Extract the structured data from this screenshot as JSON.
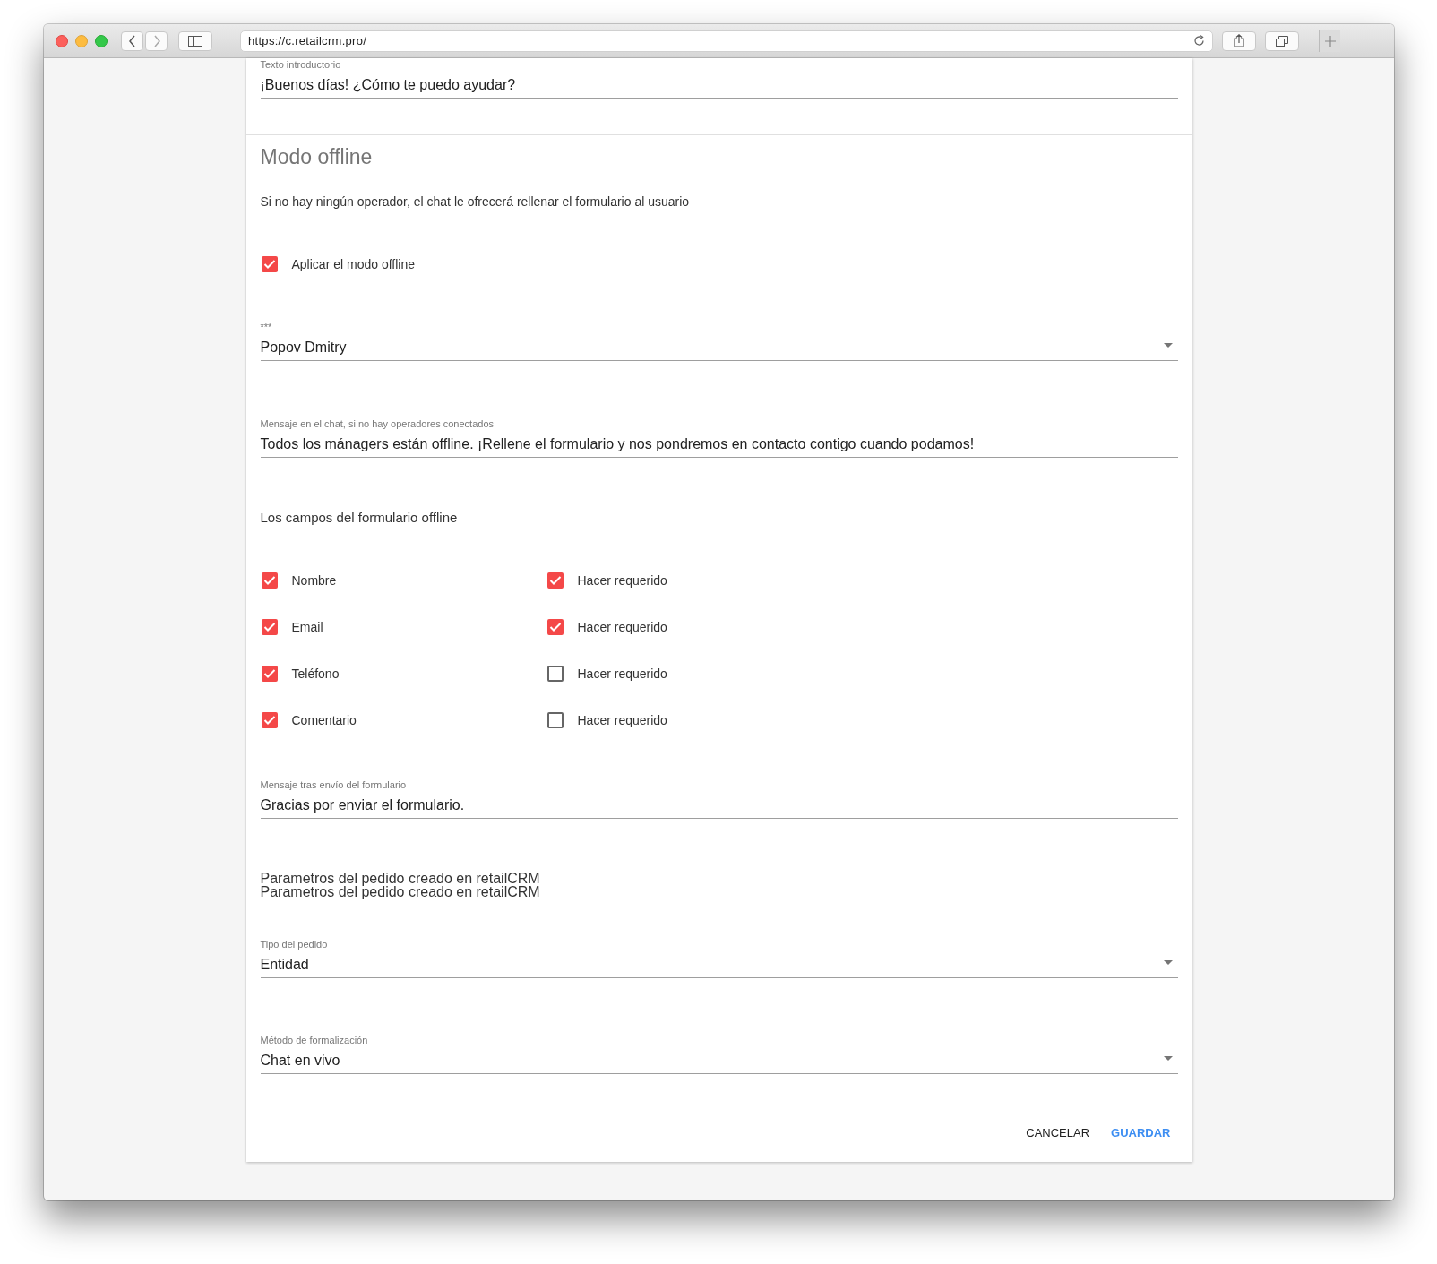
{
  "browser": {
    "url": "https://c.retailcrm.pro/"
  },
  "intro_field": {
    "label": "Texto introductorio",
    "value": "¡Buenos días! ¿Cómo te puedo ayudar?"
  },
  "offline_section": {
    "title": "Modo offline",
    "description": "Si no hay ningún operador, el chat le ofrecerá rellenar el formulario al usuario",
    "apply_checkbox": {
      "label": "Aplicar el modo offline",
      "checked": true
    },
    "operator_select": {
      "label": "***",
      "value": "Popov Dmitry"
    },
    "message_field": {
      "label": "Mensaje en el chat, si no hay operadores conectados",
      "value": "Todos los mánagers están offline. ¡Rellene el formulario y nos pondremos en contacto contigo cuando podamos!"
    },
    "form_fields_heading": "Los campos del formulario offline",
    "form_fields": [
      {
        "label": "Nombre",
        "checked": true,
        "required_label": "Hacer requerido",
        "required": true
      },
      {
        "label": "Email",
        "checked": true,
        "required_label": "Hacer requerido",
        "required": true
      },
      {
        "label": "Teléfono",
        "checked": true,
        "required_label": "Hacer requerido",
        "required": false
      },
      {
        "label": "Comentario",
        "checked": true,
        "required_label": "Hacer requerido",
        "required": false
      }
    ],
    "after_submit_field": {
      "label": "Mensaje tras envío del formulario",
      "value": "Gracias por enviar el formulario."
    },
    "order_params_lines": [
      "Parametros del pedido creado en retailCRM",
      "Parametros del pedido creado en retailCRM"
    ],
    "order_type_select": {
      "label": "Tipo del pedido",
      "value": "Entidad"
    },
    "method_select": {
      "label": "Método de formalización",
      "value": "Chat en vivo"
    }
  },
  "buttons": [
    {
      "label": "CANCELAR",
      "kind": "secondary"
    },
    {
      "label": "GUARDAR",
      "kind": "primary"
    }
  ]
}
